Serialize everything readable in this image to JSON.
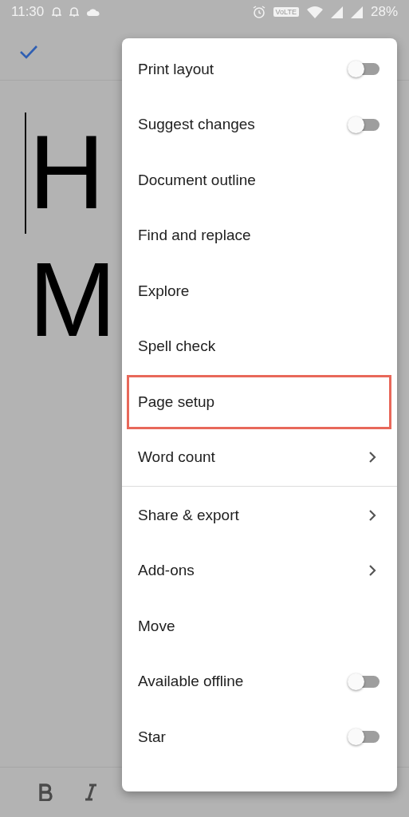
{
  "status_bar": {
    "time": "11:30",
    "network_badge": "VoLTE",
    "battery": "28%"
  },
  "document": {
    "lines": [
      "H",
      "M"
    ]
  },
  "menu": {
    "sections": [
      {
        "items": [
          {
            "label": "Print layout",
            "kind": "toggle",
            "on": false,
            "highlighted": false
          },
          {
            "label": "Suggest changes",
            "kind": "toggle",
            "on": false,
            "highlighted": false
          },
          {
            "label": "Document outline",
            "kind": "plain",
            "highlighted": false
          },
          {
            "label": "Find and replace",
            "kind": "plain",
            "highlighted": false
          },
          {
            "label": "Explore",
            "kind": "plain",
            "highlighted": false
          },
          {
            "label": "Spell check",
            "kind": "plain",
            "highlighted": false
          },
          {
            "label": "Page setup",
            "kind": "plain",
            "highlighted": true
          },
          {
            "label": "Word count",
            "kind": "submenu",
            "highlighted": false
          }
        ]
      },
      {
        "items": [
          {
            "label": "Share & export",
            "kind": "submenu",
            "highlighted": false
          },
          {
            "label": "Add-ons",
            "kind": "submenu",
            "highlighted": false
          },
          {
            "label": "Move",
            "kind": "plain",
            "highlighted": false
          },
          {
            "label": "Available offline",
            "kind": "toggle",
            "on": false,
            "highlighted": false
          },
          {
            "label": "Star",
            "kind": "toggle",
            "on": false,
            "highlighted": false
          }
        ]
      }
    ]
  }
}
